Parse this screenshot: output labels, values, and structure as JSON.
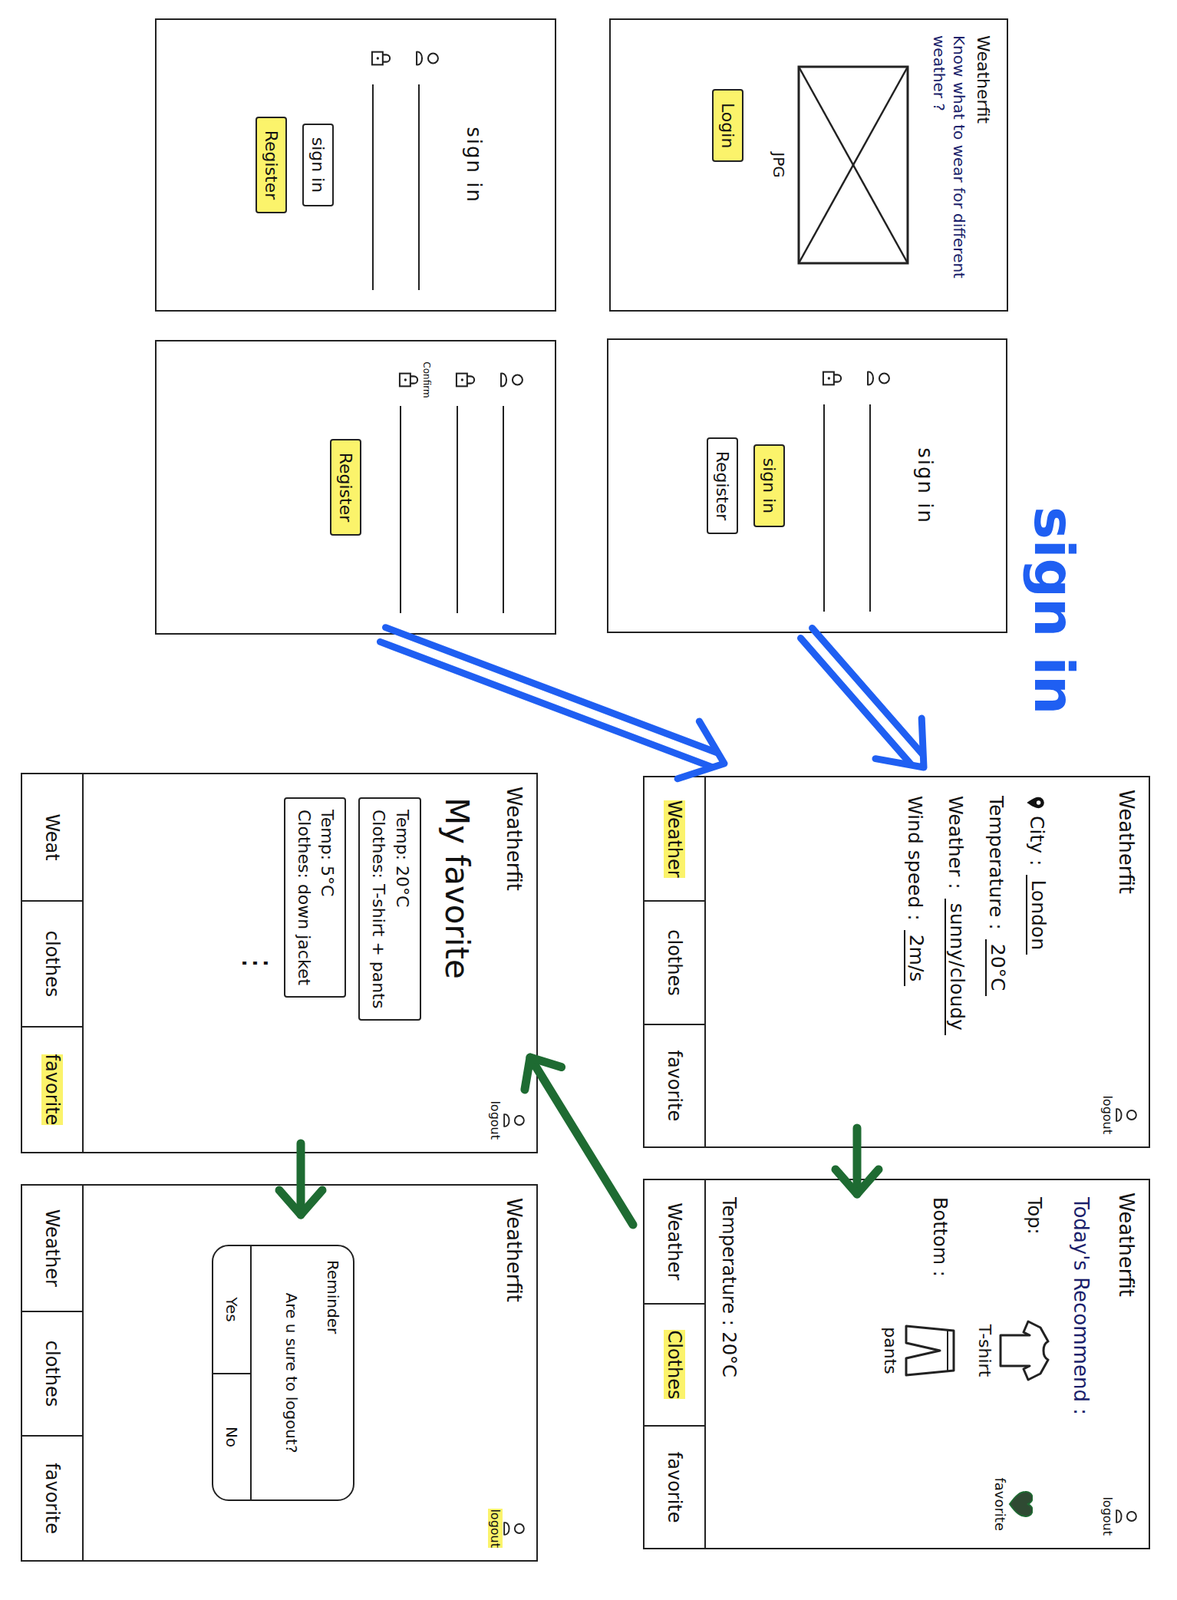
{
  "annotation": {
    "text": "sign in",
    "color": "#1f5ff2"
  },
  "arrows": [
    {
      "color": "#1f5ff2"
    },
    {
      "color": "#1f5ff2"
    },
    {
      "color": "#1e6b32"
    },
    {
      "color": "#1e6b32"
    },
    {
      "color": "#1e6b32"
    }
  ],
  "screens": [
    {
      "kind": "intro",
      "title": "Weatherfit",
      "tagline": "Know what to wear for different weather ?",
      "image_label": "JPG",
      "buttons": [
        {
          "label": "Login",
          "highlighted": true
        }
      ]
    },
    {
      "kind": "form",
      "heading": "sign in",
      "fields": [
        {
          "kind": "username"
        },
        {
          "kind": "password"
        }
      ],
      "buttons": [
        {
          "label": "sign in",
          "highlighted": false
        },
        {
          "label": "Register",
          "highlighted": true
        }
      ]
    },
    {
      "kind": "form",
      "heading": "sign in",
      "fields": [
        {
          "kind": "username"
        },
        {
          "kind": "password"
        }
      ],
      "buttons": [
        {
          "label": "sign in",
          "highlighted": true
        },
        {
          "label": "Register",
          "highlighted": false
        }
      ]
    },
    {
      "kind": "form",
      "fields": [
        {
          "kind": "username"
        },
        {
          "kind": "password"
        },
        {
          "kind": "password",
          "label": "Confirm"
        }
      ],
      "buttons": [
        {
          "label": "Register",
          "highlighted": true
        }
      ]
    },
    {
      "kind": "weather",
      "title": "Weatherfit",
      "logout": {
        "label": "logout",
        "highlighted": false
      },
      "rows": [
        {
          "kind": "location",
          "label": "City :",
          "value": "London"
        },
        {
          "kind": "plain",
          "label": "Temperature :",
          "value": "20°C"
        },
        {
          "kind": "plain",
          "label": "Weather :",
          "value": "sunny/cloudy"
        },
        {
          "kind": "plain",
          "label": "Wind speed :",
          "value": "2m/s"
        }
      ],
      "tabs": [
        {
          "label": "Weather",
          "selected": true
        },
        {
          "label": "clothes",
          "selected": false
        },
        {
          "label": "favorite",
          "selected": false
        }
      ]
    },
    {
      "kind": "clothes",
      "title": "Weatherfit",
      "logout": {
        "label": "logout",
        "highlighted": false
      },
      "heading": "Today's Recommend :",
      "items": [
        {
          "kind": "top",
          "label": "Top:",
          "name": "T-shirt"
        },
        {
          "kind": "bottom",
          "label": "Bottom :",
          "name": "pants"
        }
      ],
      "favorite": {
        "label": "favorite"
      },
      "temperature": "Temperature : 20°C",
      "tabs": [
        {
          "label": "Weather",
          "selected": false
        },
        {
          "label": "Clothes",
          "selected": true
        },
        {
          "label": "favorite",
          "selected": false
        }
      ]
    },
    {
      "kind": "favorites",
      "title": "Weatherfit",
      "logout": {
        "label": "logout",
        "highlighted": false
      },
      "heading": "My favorite",
      "cards": [
        {
          "temp": "Temp: 20°C",
          "clothes": "Clothes: T-shirt + pants"
        },
        {
          "temp": "Temp: 5°C",
          "clothes": "Clothes: down jacket"
        }
      ],
      "more": "⋮",
      "tabs": [
        {
          "label": "Weat",
          "selected": false
        },
        {
          "label": "clothes",
          "selected": false
        },
        {
          "label": "favorite",
          "selected": true
        }
      ]
    },
    {
      "kind": "logout",
      "title": "Weatherfit",
      "logout": {
        "label": "logout",
        "highlighted": true
      },
      "dialog": {
        "title": "Reminder",
        "message": "Are u sure to logout?",
        "buttons": [
          "Yes",
          "No"
        ]
      },
      "tabs": [
        {
          "label": "Weather",
          "selected": false
        },
        {
          "label": "clothes",
          "selected": false
        },
        {
          "label": "favorite",
          "selected": false
        }
      ]
    }
  ]
}
